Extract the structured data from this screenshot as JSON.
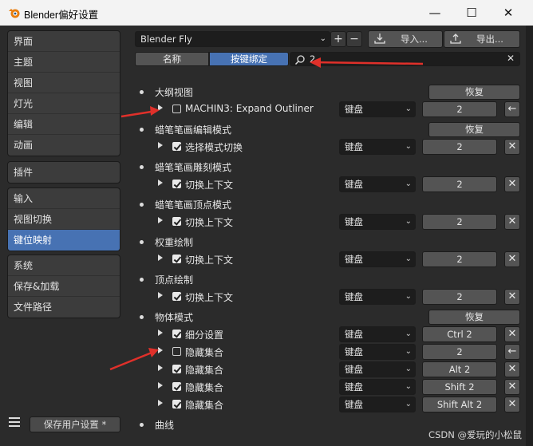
{
  "window": {
    "title": "Blender偏好设置"
  },
  "sidebar": {
    "groups": [
      [
        "界面",
        "主题",
        "视图",
        "灯光",
        "编辑",
        "动画"
      ],
      [
        "插件"
      ],
      [
        "输入",
        "视图切换",
        "键位映射"
      ],
      [
        "系统",
        "保存&加载",
        "文件路径"
      ]
    ],
    "active": "键位映射",
    "save_label": "保存用户设置 *"
  },
  "toolbar": {
    "preset": "Blender Fly",
    "add": "+",
    "remove": "−",
    "import_label": "导入...",
    "export_label": "导出..."
  },
  "tabs": {
    "name": "名称",
    "key_binding": "按键绑定"
  },
  "search": {
    "value": "2",
    "clear": "✕"
  },
  "sections": [
    {
      "title": "大纲视图",
      "restore": "恢复",
      "rows": [
        {
          "name": "MACHIN3: Expand Outliner",
          "checked": false,
          "device": "键盘",
          "key": "2",
          "action": "←"
        }
      ]
    },
    {
      "title": "蜡笔笔画编辑模式",
      "restore": "恢复",
      "rows": [
        {
          "name": "选择模式切换",
          "checked": true,
          "device": "键盘",
          "key": "2",
          "action": "✕"
        }
      ]
    },
    {
      "title": "蜡笔笔画雕刻模式",
      "rows": [
        {
          "name": "切换上下文",
          "checked": true,
          "device": "键盘",
          "key": "2",
          "action": "✕"
        }
      ]
    },
    {
      "title": "蜡笔笔画顶点模式",
      "rows": [
        {
          "name": "切换上下文",
          "checked": true,
          "device": "键盘",
          "key": "2",
          "action": "✕"
        }
      ]
    },
    {
      "title": "权重绘制",
      "rows": [
        {
          "name": "切换上下文",
          "checked": true,
          "device": "键盘",
          "key": "2",
          "action": "✕"
        }
      ]
    },
    {
      "title": "顶点绘制",
      "rows": [
        {
          "name": "切换上下文",
          "checked": true,
          "device": "键盘",
          "key": "2",
          "action": "✕"
        }
      ]
    },
    {
      "title": "物体模式",
      "restore": "恢复",
      "rows": [
        {
          "name": "细分设置",
          "checked": true,
          "device": "键盘",
          "key": "Ctrl 2",
          "action": "✕"
        },
        {
          "name": "隐藏集合",
          "checked": false,
          "device": "键盘",
          "key": "2",
          "action": "←"
        },
        {
          "name": "隐藏集合",
          "checked": true,
          "device": "键盘",
          "key": "Alt 2",
          "action": "✕"
        },
        {
          "name": "隐藏集合",
          "checked": true,
          "device": "键盘",
          "key": "Shift 2",
          "action": "✕"
        },
        {
          "name": "隐藏集合",
          "checked": true,
          "device": "键盘",
          "key": "Shift Alt 2",
          "action": "✕"
        }
      ]
    },
    {
      "title": "曲线",
      "rows": []
    }
  ],
  "watermark": "CSDN @爱玩的小松鼠",
  "colors": {
    "accent": "#4772b3",
    "arrow": "#e0302a",
    "panel": "#2b2b2b"
  }
}
